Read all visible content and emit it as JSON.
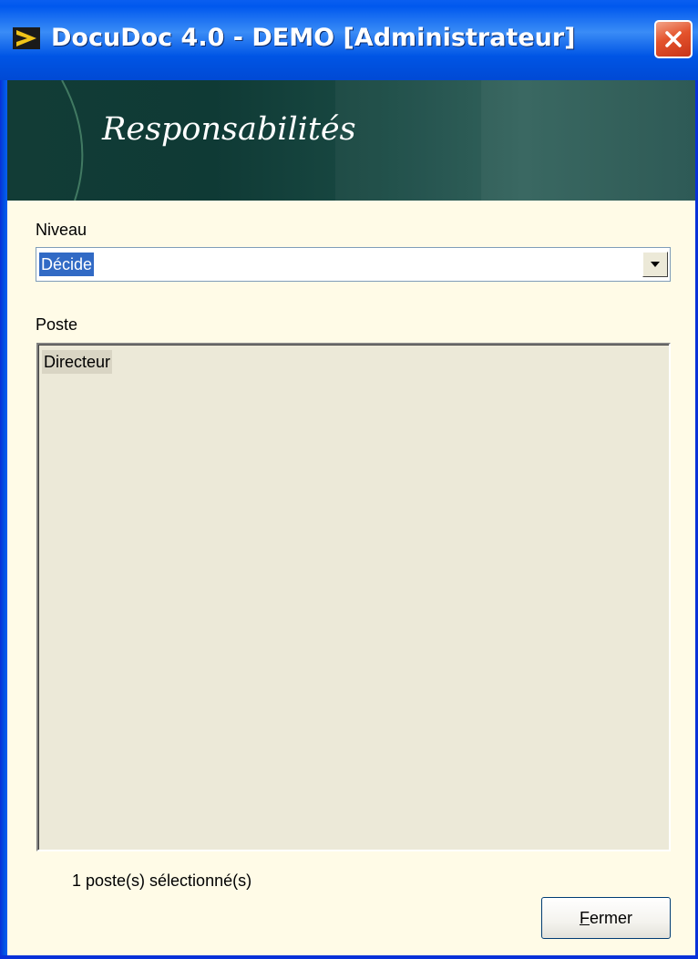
{
  "window": {
    "title": "DocuDoc 4.0 - DEMO [Administrateur]"
  },
  "banner": {
    "title": "Responsabilités"
  },
  "niveau": {
    "label": "Niveau",
    "selected": "Décide"
  },
  "poste": {
    "label": "Poste",
    "items": [
      "Directeur"
    ]
  },
  "status": {
    "text": "1  poste(s) sélectionné(s)"
  },
  "buttons": {
    "close_first": "F",
    "close_rest": "ermer"
  },
  "icons": {
    "app": "docudoc-logo-icon",
    "close": "close-icon",
    "dropdown": "chevron-down-icon"
  },
  "colors": {
    "titlebar": "#0054e3",
    "banner": "#123c36",
    "client": "#fffbe7",
    "selection": "#316ac5",
    "close": "#e4532c"
  }
}
